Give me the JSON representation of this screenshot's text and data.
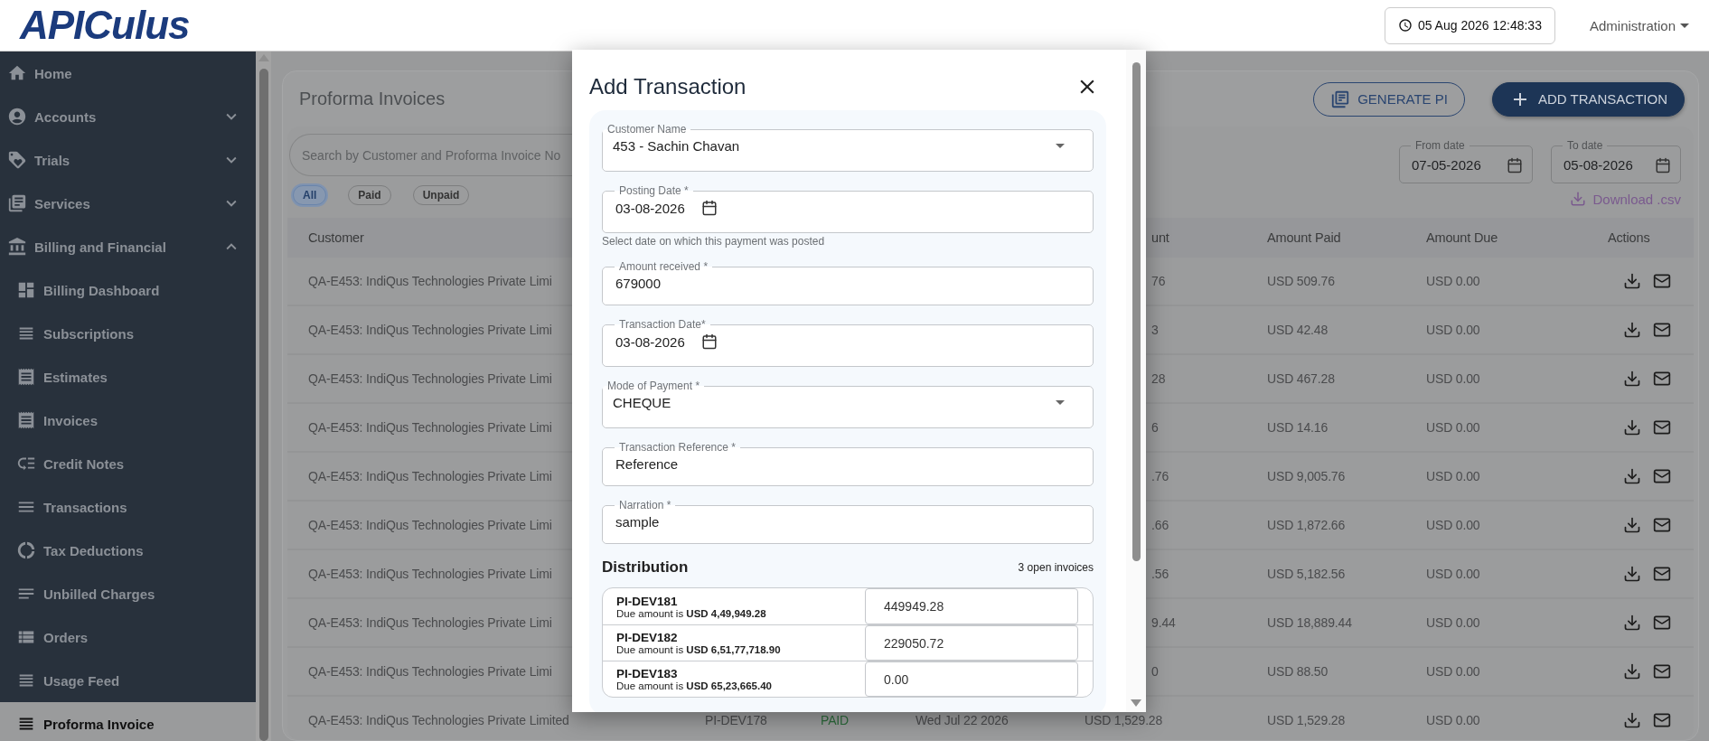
{
  "header": {
    "logo": "APICulus",
    "clock": "05 Aug 2026 12:48:33",
    "user_menu": "Administration"
  },
  "sidebar": {
    "items": [
      {
        "label": "Home"
      },
      {
        "label": "Accounts",
        "expanded": false
      },
      {
        "label": "Trials",
        "expanded": false
      },
      {
        "label": "Services",
        "expanded": false
      },
      {
        "label": "Billing and Financial",
        "expanded": true,
        "children": [
          {
            "label": "Billing Dashboard",
            "selected": false
          },
          {
            "label": "Subscriptions",
            "selected": false
          },
          {
            "label": "Estimates",
            "selected": false
          },
          {
            "label": "Invoices",
            "selected": false
          },
          {
            "label": "Credit Notes",
            "selected": false
          },
          {
            "label": "Transactions",
            "selected": false
          },
          {
            "label": "Tax Deductions",
            "selected": false
          },
          {
            "label": "Unbilled Charges",
            "selected": false
          },
          {
            "label": "Orders",
            "selected": false
          },
          {
            "label": "Usage Feed",
            "selected": false
          },
          {
            "label": "Proforma Invoice",
            "selected": true
          }
        ]
      }
    ]
  },
  "page": {
    "title": "Proforma Invoices",
    "buttons": [
      {
        "kind": "outline",
        "label": "GENERATE PI"
      },
      {
        "kind": "primary",
        "label": "ADD TRANSACTION"
      }
    ],
    "search": {
      "placeholder": "Search by Customer and Proforma Invoice No"
    },
    "filters": [
      {
        "label": "All",
        "selected": true
      },
      {
        "label": "Paid",
        "selected": false
      },
      {
        "label": "Unpaid",
        "selected": false
      }
    ],
    "from_date": {
      "label": "From date",
      "value": "07-05-2026"
    },
    "to_date": {
      "label": "To date",
      "value": "05-08-2026"
    },
    "download": "Download .csv"
  },
  "table": {
    "columns": {
      "customer": "Customer",
      "amount": "unt",
      "paid": "Amount Paid",
      "due": "Amount Due",
      "actions": "Actions"
    },
    "rows": [
      {
        "customer": "QA-E453: IndiQus Technologies Private Limi",
        "amount": "76",
        "paid": "USD 509.76",
        "due": "USD 0.00"
      },
      {
        "customer": "QA-E453: IndiQus Technologies Private Limi",
        "amount": "3",
        "paid": "USD 42.48",
        "due": "USD 0.00"
      },
      {
        "customer": "QA-E453: IndiQus Technologies Private Limi",
        "amount": "28",
        "paid": "USD 467.28",
        "due": "USD 0.00"
      },
      {
        "customer": "QA-E453: IndiQus Technologies Private Limi",
        "amount": "6",
        "paid": "USD 14.16",
        "due": "USD 0.00"
      },
      {
        "customer": "QA-E453: IndiQus Technologies Private Limi",
        "amount": ".76",
        "paid": "USD 9,005.76",
        "due": "USD 0.00"
      },
      {
        "customer": "QA-E453: IndiQus Technologies Private Limi",
        "amount": ".66",
        "paid": "USD 1,872.66",
        "due": "USD 0.00"
      },
      {
        "customer": "QA-E453: IndiQus Technologies Private Limi",
        "amount": ".56",
        "paid": "USD 5,182.56",
        "due": "USD 0.00"
      },
      {
        "customer": "QA-E453: IndiQus Technologies Private Limi",
        "amount": "9.44",
        "paid": "USD 18,889.44",
        "due": "USD 0.00"
      },
      {
        "customer": "QA-E453: IndiQus Technologies Private Limi",
        "amount": "0",
        "paid": "USD 88.50",
        "due": "USD 0.00"
      },
      {
        "customer": "QA-E453: IndiQus Technologies Private Limited",
        "invoice": "PI-DEV178",
        "status": "PAID",
        "date": "Wed Jul 22 2026",
        "amount": "USD 1,529.28",
        "paid": "USD 1,529.28",
        "due": "USD 0.00"
      }
    ]
  },
  "modal": {
    "title": "Add Transaction",
    "fields": [
      {
        "kind": "select",
        "label": "Customer Name",
        "value": "453 - Sachin Chavan"
      },
      {
        "kind": "date",
        "label": "Posting Date *",
        "value": "03-08-2026",
        "helper": "Select date on which this payment was posted"
      },
      {
        "kind": "text",
        "label": "Amount received *",
        "value": "679000"
      },
      {
        "kind": "date",
        "label": "Transaction Date*",
        "value": "03-08-2026"
      },
      {
        "kind": "select",
        "label": "Mode of Payment *",
        "value": "CHEQUE"
      },
      {
        "kind": "text",
        "label": "Transaction Reference *",
        "value": "Reference"
      },
      {
        "kind": "text",
        "label": "Narration *",
        "value": "sample"
      }
    ],
    "distribution": {
      "title": "Distribution",
      "count": "3 open invoices",
      "invoices": [
        {
          "number": "PI-DEV181",
          "due": "Due amount is **USD 4,49,949.28**",
          "amount": "449949.28"
        },
        {
          "number": "PI-DEV182",
          "due": "Due amount is **USD 6,51,77,718.90**",
          "amount": "229050.72"
        },
        {
          "number": "PI-DEV183",
          "due": "Due amount is **USD 65,23,665.40**",
          "amount": "0.00"
        }
      ]
    }
  }
}
